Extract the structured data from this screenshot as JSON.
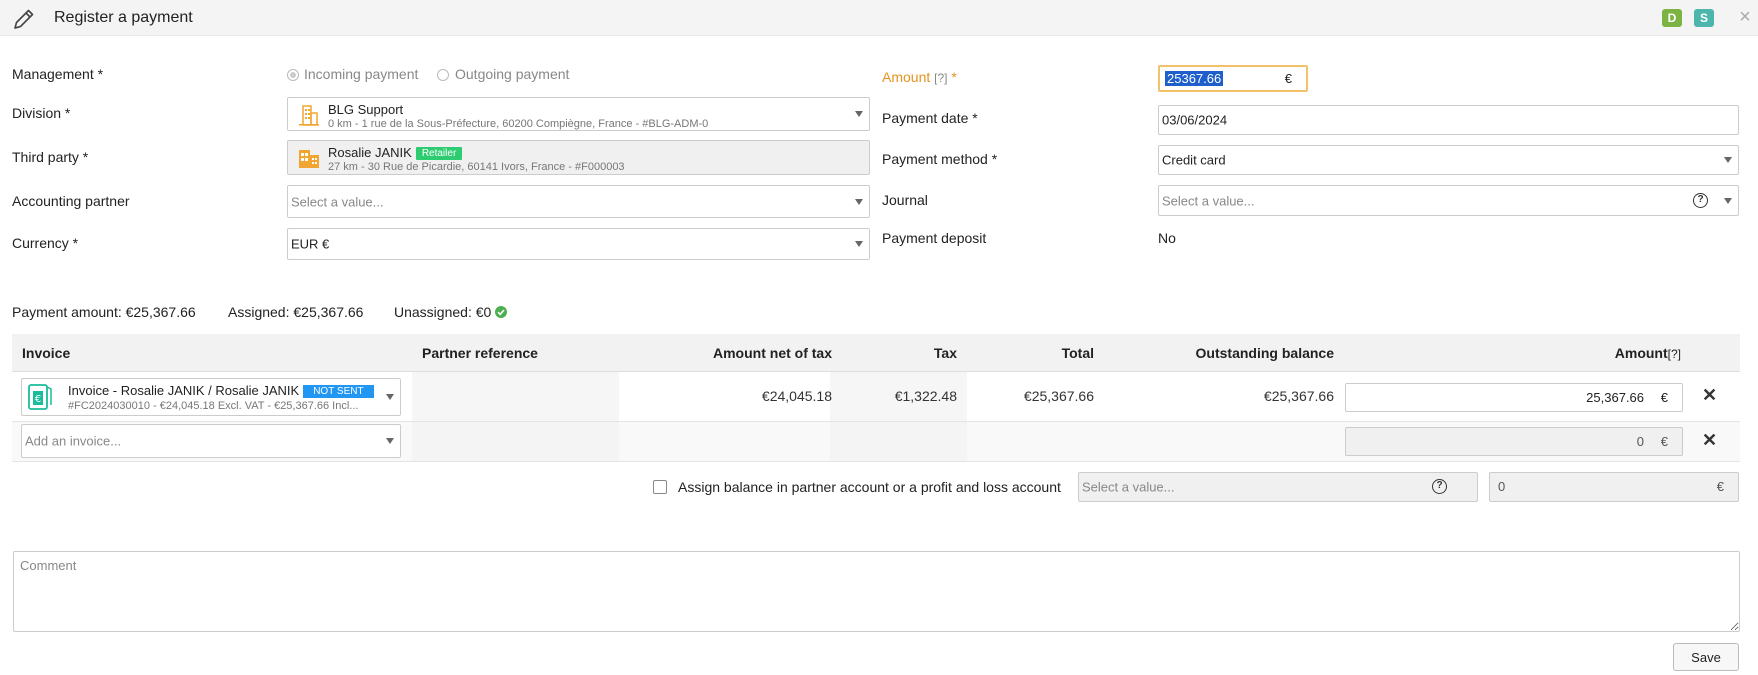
{
  "window": {
    "title": "Register a payment",
    "badge_d": "D",
    "badge_s": "S",
    "close": "×"
  },
  "colors": {
    "badge_d": "#7cb342",
    "badge_s": "#4db6ac",
    "required_amount": "#e6921e",
    "retailer": "#2ecc71",
    "not_sent": "#2196f3",
    "ok": "#4caf50"
  },
  "left": {
    "management": {
      "label": "Management *",
      "option_incoming": "Incoming payment",
      "option_outgoing": "Outgoing payment",
      "selected": "incoming"
    },
    "division": {
      "label": "Division *",
      "name": "BLG Support",
      "detail": "0 km - 1 rue de la Sous-Préfecture, 60200 Compiègne, France - #BLG-ADM-0"
    },
    "third_party": {
      "label": "Third party *",
      "name": "Rosalie JANIK",
      "tag": "Retailer",
      "detail": "27 km - 30 Rue de Picardie, 60141 Ivors, France - #F000003"
    },
    "accounting_partner": {
      "label": "Accounting partner",
      "placeholder": "Select a value..."
    },
    "currency": {
      "label": "Currency *",
      "value": "EUR €"
    }
  },
  "right": {
    "amount": {
      "label": "Amount",
      "help": "[?]",
      "required": "*",
      "value": "25367.66",
      "unit": "€"
    },
    "payment_date": {
      "label": "Payment date *",
      "value": "03/06/2024"
    },
    "payment_method": {
      "label": "Payment method *",
      "value": "Credit card"
    },
    "journal": {
      "label": "Journal",
      "placeholder": "Select a value...",
      "help": "?"
    },
    "payment_deposit": {
      "label": "Payment deposit",
      "value": "No"
    }
  },
  "summary": {
    "payment_amount": "Payment amount: €25,367.66",
    "assigned": "Assigned: €25,367.66",
    "unassigned": "Unassigned: €0"
  },
  "table": {
    "headers": {
      "invoice": "Invoice",
      "partner_ref": "Partner reference",
      "net": "Amount net of tax",
      "tax": "Tax",
      "total": "Total",
      "outstanding": "Outstanding balance",
      "amount": "Amount",
      "amount_help": "[?]"
    },
    "rows": [
      {
        "invoice_title": "Invoice - Rosalie JANIK / Rosalie JANIK",
        "status": "NOT SENT",
        "invoice_detail": "#FC2024030010 - €24,045.18 Excl. VAT - €25,367.66 Incl...",
        "partner_ref": "",
        "net": "€24,045.18",
        "tax": "€1,322.48",
        "total": "€25,367.66",
        "outstanding": "€25,367.66",
        "amount": "25,367.66",
        "unit": "€"
      }
    ],
    "add_row": {
      "placeholder": "Add an invoice...",
      "amount": "0",
      "unit": "€"
    }
  },
  "balance": {
    "label": "Assign balance in partner account or a profit and loss account",
    "placeholder": "Select a value...",
    "help": "?",
    "amount": "0",
    "unit": "€"
  },
  "comment": {
    "placeholder": "Comment"
  },
  "footer": {
    "save": "Save"
  }
}
